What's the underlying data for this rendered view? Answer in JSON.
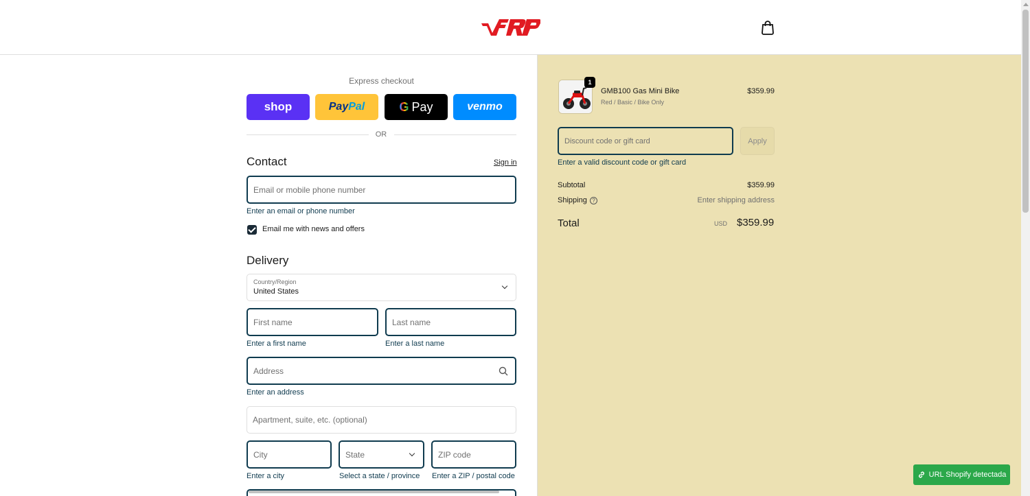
{
  "header": {
    "logo_text": "FRP",
    "cart_icon": "shopping-bag-icon"
  },
  "express": {
    "title": "Express checkout",
    "shop_label": "shop",
    "paypal_label_1": "Pay",
    "paypal_label_2": "Pal",
    "gpay_g": "G",
    "gpay_label": "Pay",
    "venmo_label": "venmo",
    "or_label": "OR"
  },
  "contact": {
    "title": "Contact",
    "sign_in": "Sign in",
    "email_placeholder": "Email or mobile phone number",
    "email_error": "Enter an email or phone number",
    "newsletter_label": "Email me with news and offers"
  },
  "delivery": {
    "title": "Delivery",
    "country_label": "Country/Region",
    "country_value": "United States",
    "first_name_placeholder": "First name",
    "first_name_error": "Enter a first name",
    "last_name_placeholder": "Last name",
    "last_name_error": "Enter a last name",
    "address_placeholder": "Address",
    "address_error": "Enter an address",
    "apartment_placeholder": "Apartment, suite, etc. (optional)",
    "city_placeholder": "City",
    "city_error": "Enter a city",
    "state_placeholder": "State",
    "state_error": "Select a state / province",
    "zip_placeholder": "ZIP code",
    "zip_error": "Enter a ZIP / postal code"
  },
  "order": {
    "quantity": "1",
    "product_name": "GMB100 Gas Mini Bike",
    "product_variant": "Red / Basic / Bike Only",
    "product_price": "$359.99",
    "discount_placeholder": "Discount code or gift card",
    "apply_label": "Apply",
    "discount_error": "Enter a valid discount code or gift card",
    "subtotal_label": "Subtotal",
    "subtotal_value": "$359.99",
    "shipping_label": "Shipping",
    "shipping_value": "Enter shipping address",
    "total_label": "Total",
    "total_currency": "USD",
    "total_value": "$359.99"
  },
  "extension": {
    "badge_label": "URL Shopify detectada"
  },
  "colors": {
    "summary_bg": "#ece1b3",
    "field_border": "#0e3a4e",
    "shop_purple": "#5a31f4",
    "paypal_yellow": "#ffc439",
    "venmo_blue": "#008cff",
    "badge_green": "#2ba84a"
  }
}
